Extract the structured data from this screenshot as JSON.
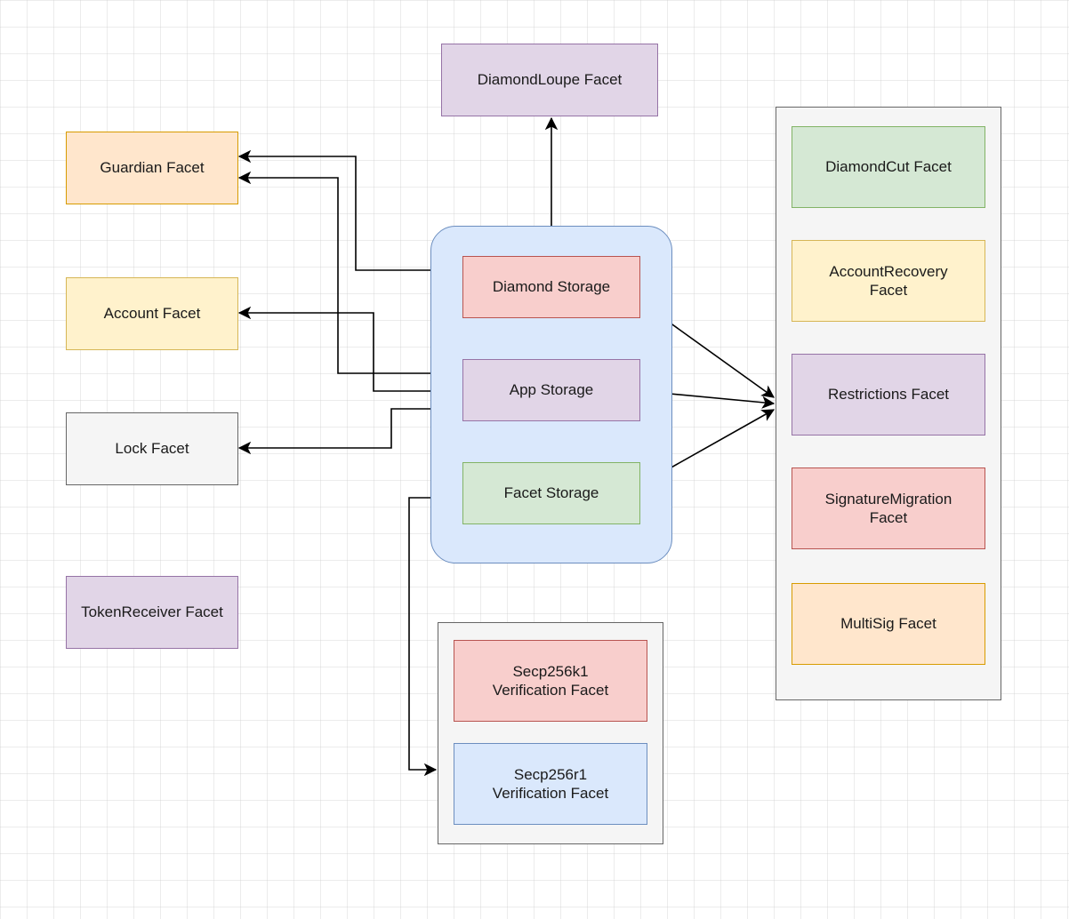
{
  "diagram": {
    "nodes": {
      "diamondLoupe": "DiamondLoupe Facet",
      "guardian": "Guardian Facet",
      "account": "Account Facet",
      "lock": "Lock Facet",
      "tokenReceiver": "TokenReceiver Facet",
      "diamondStorage": "Diamond Storage",
      "appStorage": "App Storage",
      "facetStorage": "Facet Storage",
      "secp256k1": "Secp256k1\nVerification Facet",
      "secp256r1": "Secp256r1\nVerification Facet",
      "diamondCut": "DiamondCut Facet",
      "accountRecovery": "AccountRecovery\nFacet",
      "restrictions": "Restrictions Facet",
      "signatureMigration": "SignatureMigration\nFacet",
      "multiSig": "MultiSig Facet"
    }
  }
}
